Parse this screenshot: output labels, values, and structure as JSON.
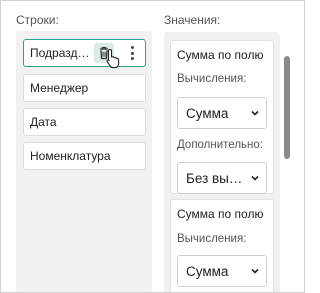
{
  "rows_section": {
    "title": "Строки:",
    "items": [
      {
        "label": "Подразделение",
        "selected": true
      },
      {
        "label": "Менеджер",
        "selected": false
      },
      {
        "label": "Дата",
        "selected": false
      },
      {
        "label": "Номенклатура",
        "selected": false
      }
    ]
  },
  "values_section": {
    "title": "Значения:",
    "cards": [
      {
        "title": "Сумма по полю",
        "calc_label": "Вычисления:",
        "calc_value": "Сумма",
        "extra_label": "Дополнительно:",
        "extra_value": "Без вычислений"
      },
      {
        "title": "Сумма по полю",
        "calc_label": "Вычисления:",
        "calc_value": "Сумма"
      }
    ]
  },
  "colors": {
    "accent": "#2aa590",
    "accent_light": "#d9ebe7",
    "panel_bg": "#f1f1f1",
    "scroll_thumb": "#8a8a8a"
  },
  "icons": [
    "trash-icon",
    "kebab-menu-icon",
    "chevron-down-icon",
    "mouse-pointer-icon"
  ]
}
